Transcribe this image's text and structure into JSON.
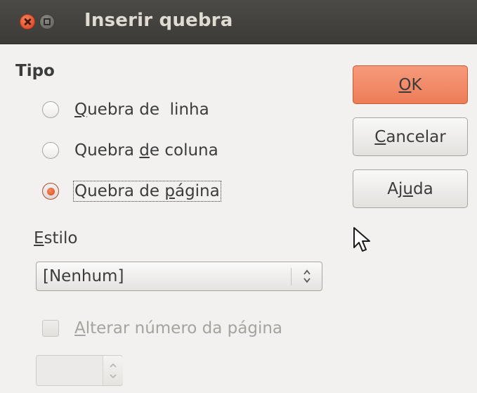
{
  "window": {
    "title": "Inserir quebra"
  },
  "tipo": {
    "label": "Tipo",
    "options": [
      {
        "mnemonic": "Q",
        "rest": "uebra de  linha",
        "checked": false
      },
      {
        "before": "Quebra ",
        "mnemonic": "d",
        "after": "e coluna",
        "checked": false
      },
      {
        "before": "Quebra de ",
        "mnemonic": "p",
        "after": "ágina",
        "checked": true
      }
    ]
  },
  "estilo": {
    "mnemonic": "E",
    "rest": "stilo",
    "selected": "[Nenhum]"
  },
  "page_number": {
    "mnemonic": "A",
    "rest": "lterar número da página",
    "checked": false,
    "enabled": false,
    "value": ""
  },
  "buttons": {
    "ok": {
      "mnemonic": "O",
      "rest": "K"
    },
    "cancel": {
      "mnemonic": "C",
      "rest": "ancelar"
    },
    "help": {
      "before": "Aj",
      "mnemonic": "u",
      "after": "da"
    }
  },
  "colors": {
    "accent": "#ee7d58",
    "titlebar": "#3c3b37",
    "background": "#f2f1f0"
  }
}
